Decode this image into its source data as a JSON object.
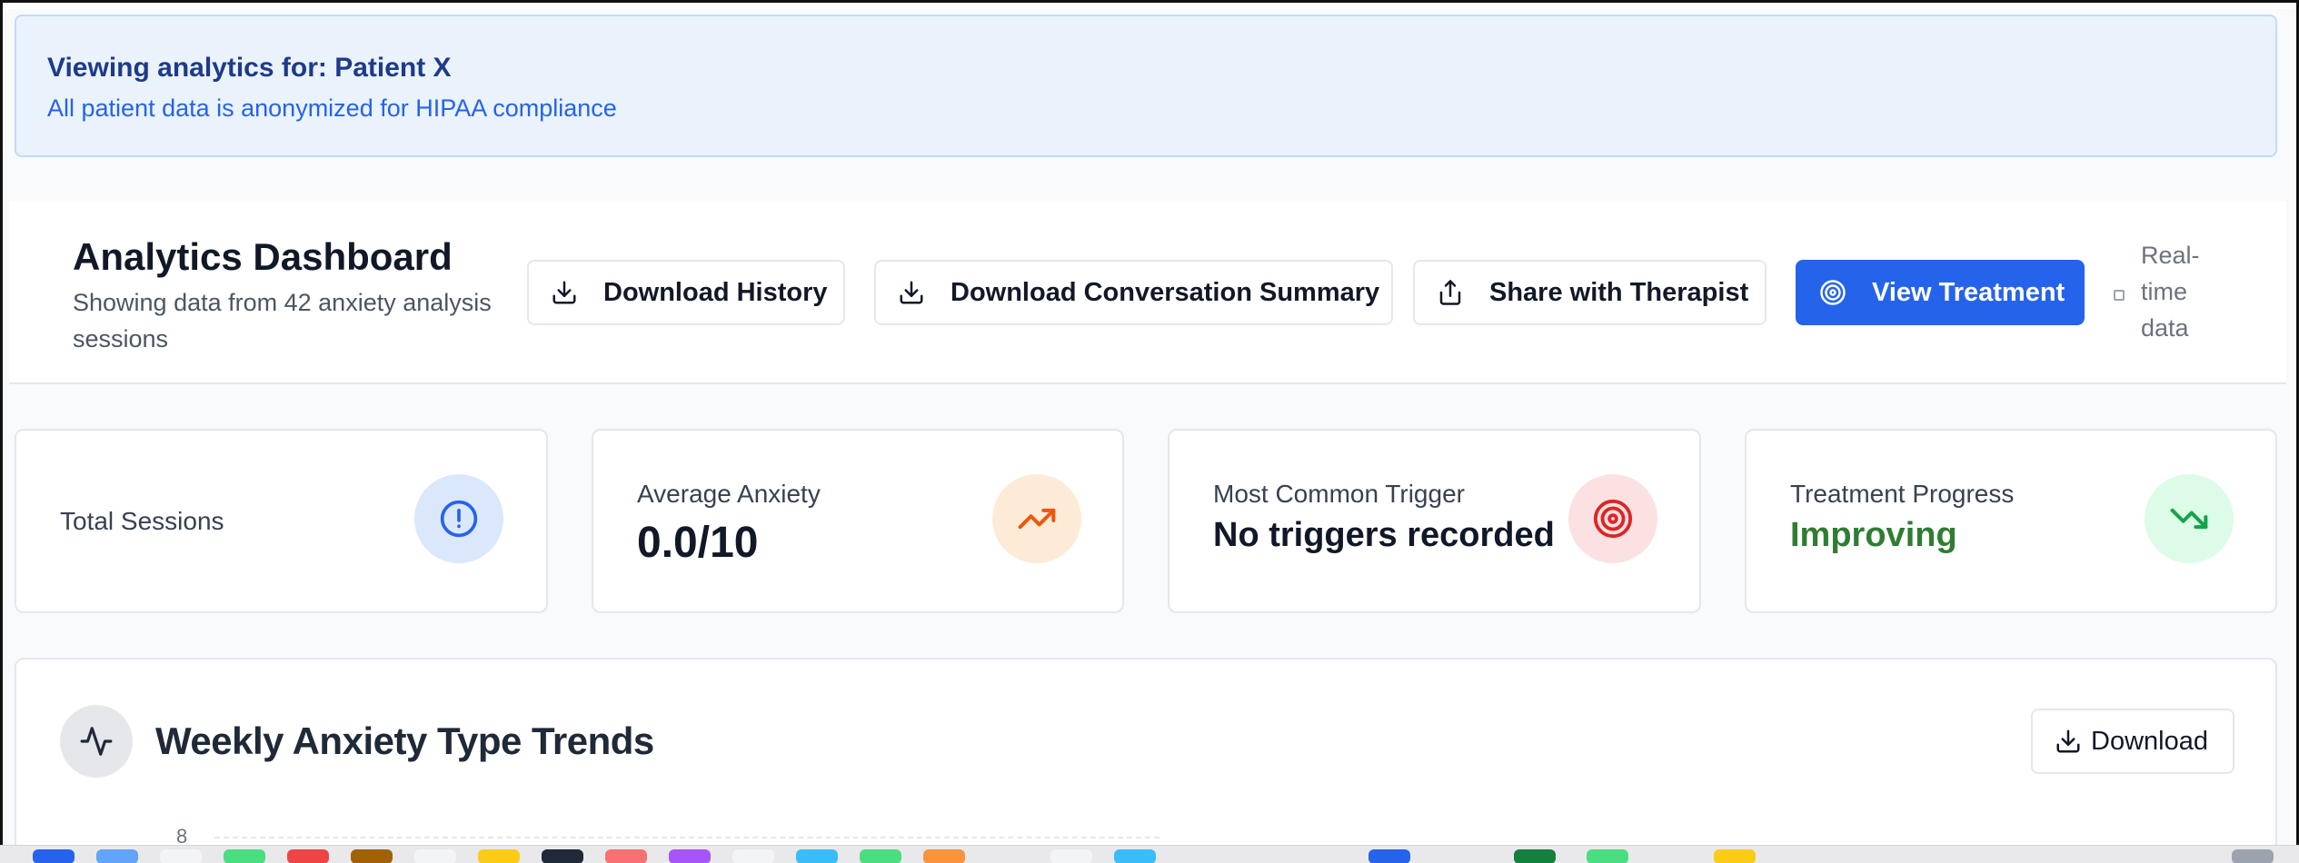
{
  "banner": {
    "title": "Viewing analytics for: Patient X",
    "subtitle": "All patient data is anonymized for HIPAA compliance"
  },
  "header": {
    "title": "Analytics Dashboard",
    "subtitle": "Showing data from 42 anxiety analysis sessions",
    "buttons": {
      "download_history": "Download History",
      "download_summary": "Download Conversation Summary",
      "share": "Share with Therapist",
      "view_treatment": "View Treatment"
    },
    "realtime_label": "Real-time data"
  },
  "cards": {
    "total_sessions": {
      "label": "Total Sessions",
      "icon": "alert-circle-icon",
      "accent": "#2563eb"
    },
    "average_anxiety": {
      "label": "Average Anxiety",
      "value": "0.0/10",
      "icon": "trending-up-icon",
      "accent": "#ea580c"
    },
    "common_trigger": {
      "label": "Most Common Trigger",
      "value": "No triggers recorded",
      "icon": "target-icon",
      "accent": "#dc2626"
    },
    "treatment_progress": {
      "label": "Treatment Progress",
      "value": "Improving",
      "icon": "trending-down-icon",
      "accent": "#16a34a"
    }
  },
  "weekly_section": {
    "title": "Weekly Anxiety Type Trends",
    "download_label": "Download",
    "icon": "activity-icon",
    "y_tick_top": "8"
  },
  "colors": {
    "primary": "#2563eb",
    "banner_bg": "#eaf2fc",
    "success": "#2e7d32"
  }
}
